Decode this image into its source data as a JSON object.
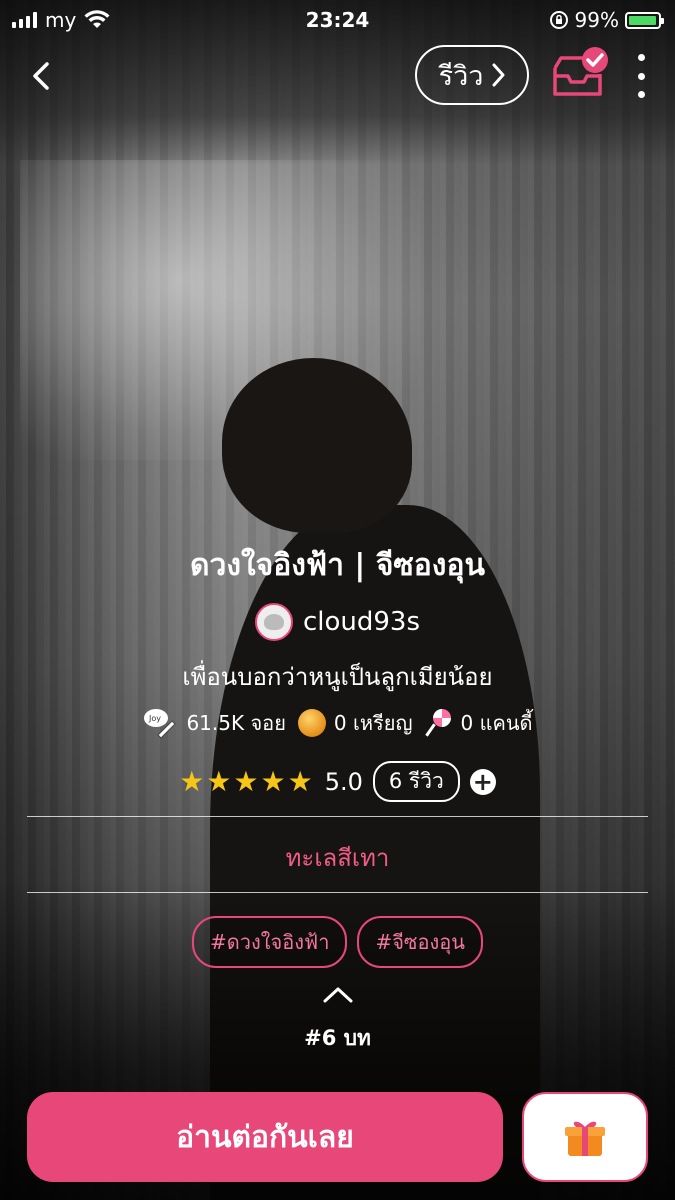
{
  "status_bar": {
    "carrier": "my",
    "time": "23:24",
    "battery": "99%"
  },
  "nav": {
    "review_label": "รีวิว",
    "icons": [
      "chevron-left-icon",
      "chevron-right-icon",
      "inbox-check-icon",
      "more-vertical-icon"
    ]
  },
  "story": {
    "title": "ดวงใจอิงฟ้า | จีซองอุน",
    "author": "cloud93s",
    "description": "เพื่อนบอกว่าหนูเป็นลูกเมียน้อย",
    "stats": {
      "joy": "61.5K จอย",
      "coins": "0 เหรียญ",
      "candy": "0 แคนดี้"
    },
    "rating": {
      "stars": 5,
      "stars_display": "★★★★★",
      "score": "5.0",
      "review_count": "6 รีวิว",
      "add_symbol": "+"
    },
    "category": "ทะเลสีเทา",
    "tags": [
      "#ดวงใจอิงฟ้า",
      "#จีซองอุน"
    ],
    "chapter": "#6 บท"
  },
  "actions": {
    "read_button": "อ่านต่อกันเลย",
    "gift_icon": "gift-icon"
  },
  "colors": {
    "accent": "#e8477a",
    "category_text": "#f15c89",
    "star": "#f5c518",
    "battery": "#4cd964"
  }
}
